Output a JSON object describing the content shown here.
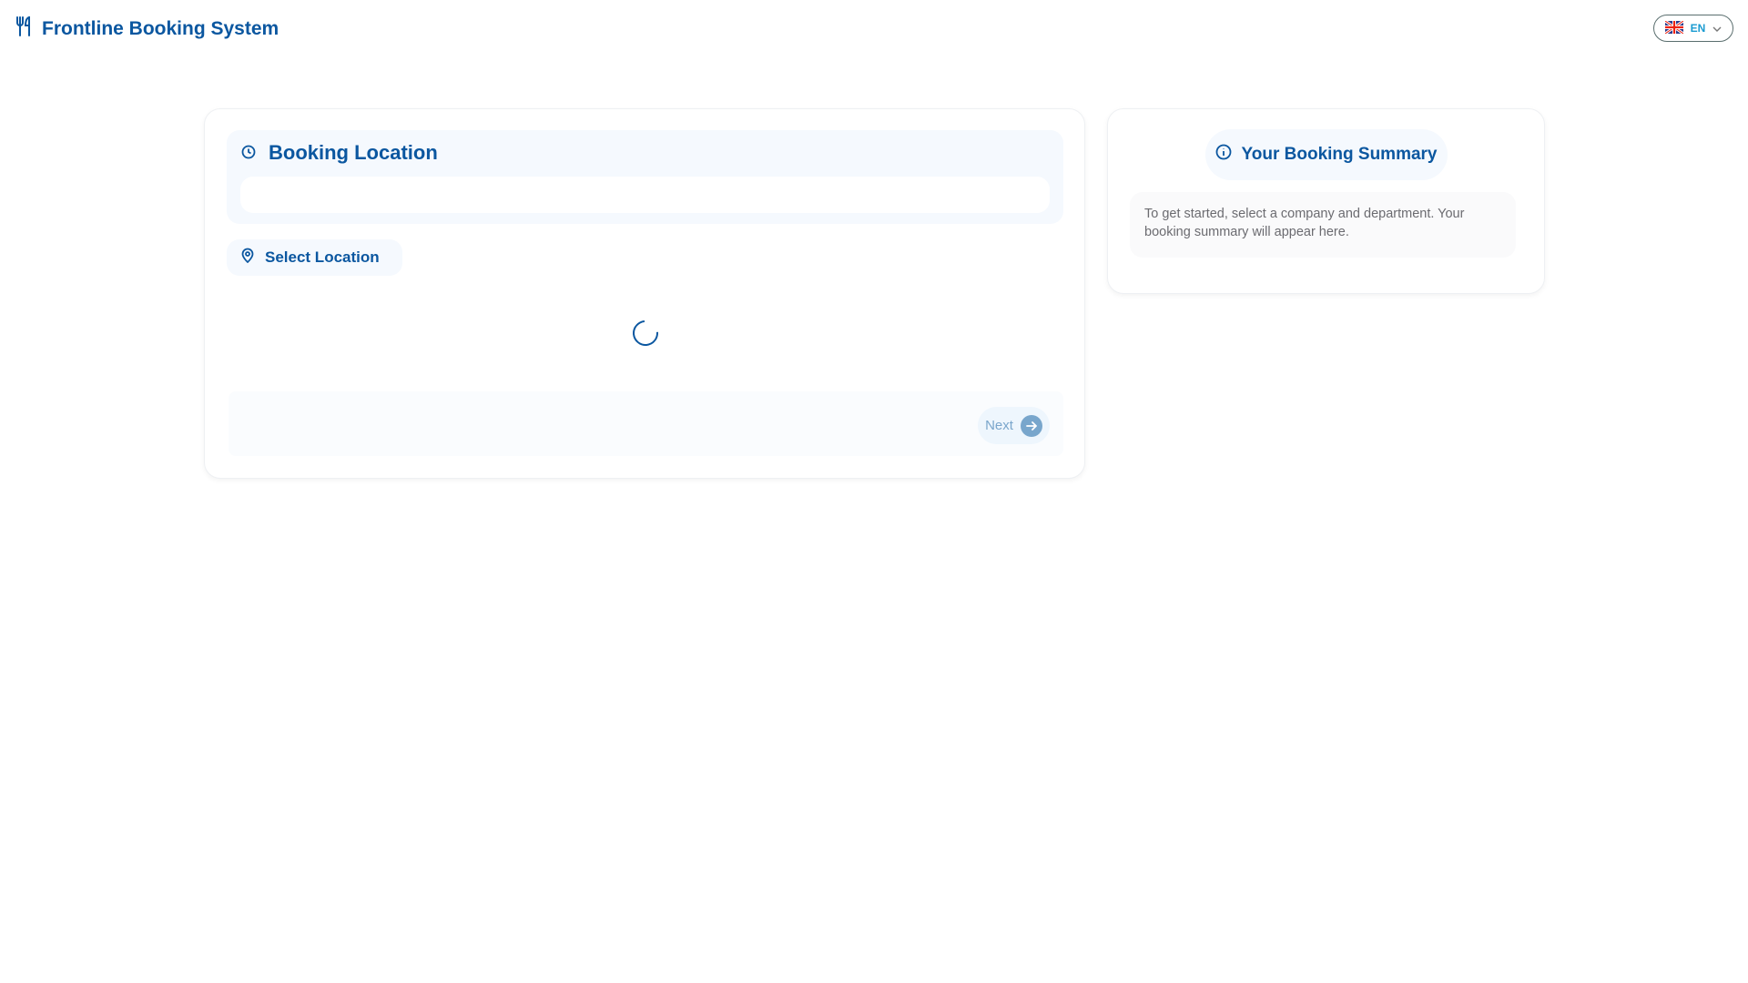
{
  "header": {
    "title": "Frontline Booking System",
    "language": "EN",
    "icons": {
      "brand": "utensils-icon",
      "flag": "uk-flag-icon",
      "chevron": "chevron-down-icon"
    }
  },
  "booking": {
    "title": "Booking Location",
    "select_label": "Select Location",
    "next_label": "Next",
    "icons": {
      "title": "clock-icon",
      "select": "map-pin-icon",
      "next": "arrow-right-icon",
      "loading": "spinner-icon"
    }
  },
  "summary": {
    "title": "Your Booking Summary",
    "text": "To get started, select a company and department. Your booking summary will appear here.",
    "icon": "info-icon"
  },
  "colors": {
    "primary": "#0b57a0",
    "accent": "#1a9bd1"
  }
}
